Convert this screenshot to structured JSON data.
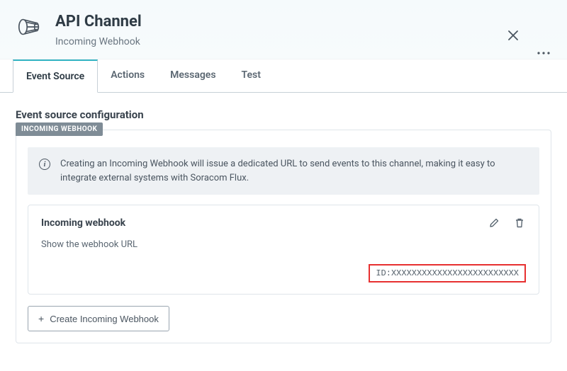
{
  "header": {
    "title": "API Channel",
    "subtitle": "Incoming Webhook"
  },
  "tabs": [
    {
      "label": "Event Source",
      "active": true
    },
    {
      "label": "Actions",
      "active": false
    },
    {
      "label": "Messages",
      "active": false
    },
    {
      "label": "Test",
      "active": false
    }
  ],
  "section_title": "Event source configuration",
  "panel_badge": "INCOMING WEBHOOK",
  "info_text": "Creating an Incoming Webhook will issue a dedicated URL to send events to this channel, making it easy to integrate external systems with Soracom Flux.",
  "card": {
    "title": "Incoming webhook",
    "show_url_label": "Show the webhook URL",
    "id_text": "ID:XXXXXXXXXXXXXXXXXXXXXXXXX"
  },
  "create_button_label": "Create Incoming Webhook"
}
